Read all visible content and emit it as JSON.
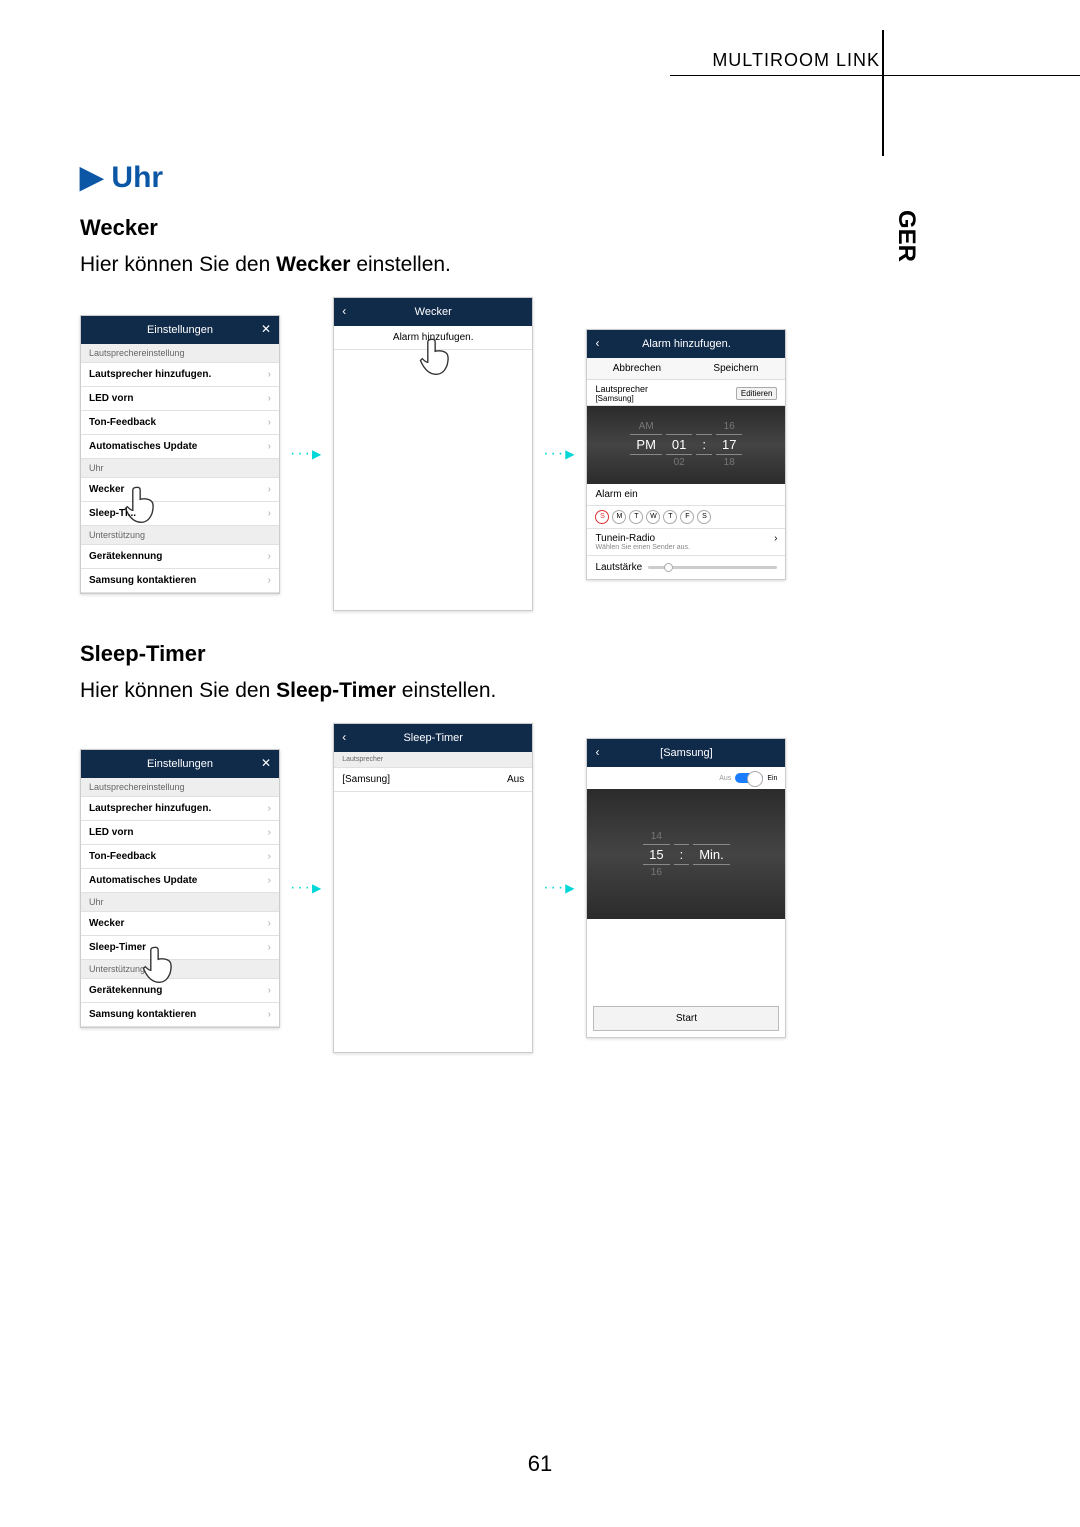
{
  "header": {
    "section": "MULTIROOM LINK",
    "lang": "GER"
  },
  "title": "Uhr",
  "wecker": {
    "heading": "Wecker",
    "desc_pre": "Hier können Sie den ",
    "desc_bold": "Wecker",
    "desc_post": " einstellen."
  },
  "sleep": {
    "heading": "Sleep-Timer",
    "desc_pre": "Hier können Sie den ",
    "desc_bold": "Sleep-Timer",
    "desc_post": " einstellen."
  },
  "settings": {
    "title": "Einstellungen",
    "sec_speaker": "Lautsprechereinstellung",
    "addspeaker": "Lautsprecher hinzufugen.",
    "led": "LED vorn",
    "tonfb": "Ton-Feedback",
    "autoupd": "Automatisches Update",
    "sec_uhr": "Uhr",
    "wecker": "Wecker",
    "sleeptA": "Sleep-Ti...",
    "sleeptB": "Sleep-Timer",
    "sec_support": "Unterstützung",
    "device": "Gerätekennung",
    "contact": "Samsung kontaktieren"
  },
  "weckerScreen": {
    "title": "Wecker",
    "add": "Alarm hinzufugen."
  },
  "alarmAdd": {
    "title": "Alarm hinzufugen.",
    "cancel": "Abbrechen",
    "save": "Speichern",
    "speaker_label": "Lautsprecher",
    "speaker_value": "[Samsung]",
    "edit": "Editieren",
    "ampm_top": "AM",
    "ampm_sel": "PM",
    "h_sel": "01",
    "h_bot": "02",
    "m_top": "16",
    "m_sel": "17",
    "m_bot": "18",
    "alarm_on": "Alarm ein",
    "days": [
      "S",
      "M",
      "T",
      "W",
      "T",
      "F",
      "S"
    ],
    "tunein": "Tunein-Radio",
    "tunein_sub": "Wählen Sie einen Sender aus.",
    "vol": "Lautstärke"
  },
  "sleepList": {
    "title": "Sleep-Timer",
    "section": "Lautsprecher",
    "name": "[Samsung]",
    "value": "Aus"
  },
  "samsungTimer": {
    "title": "[Samsung]",
    "aus": "Aus",
    "ein": "Ein",
    "t_top": "14",
    "t_sel": "15",
    "t_bot": "16",
    "unit": "Min.",
    "start": "Start"
  },
  "pageNumber": "61"
}
